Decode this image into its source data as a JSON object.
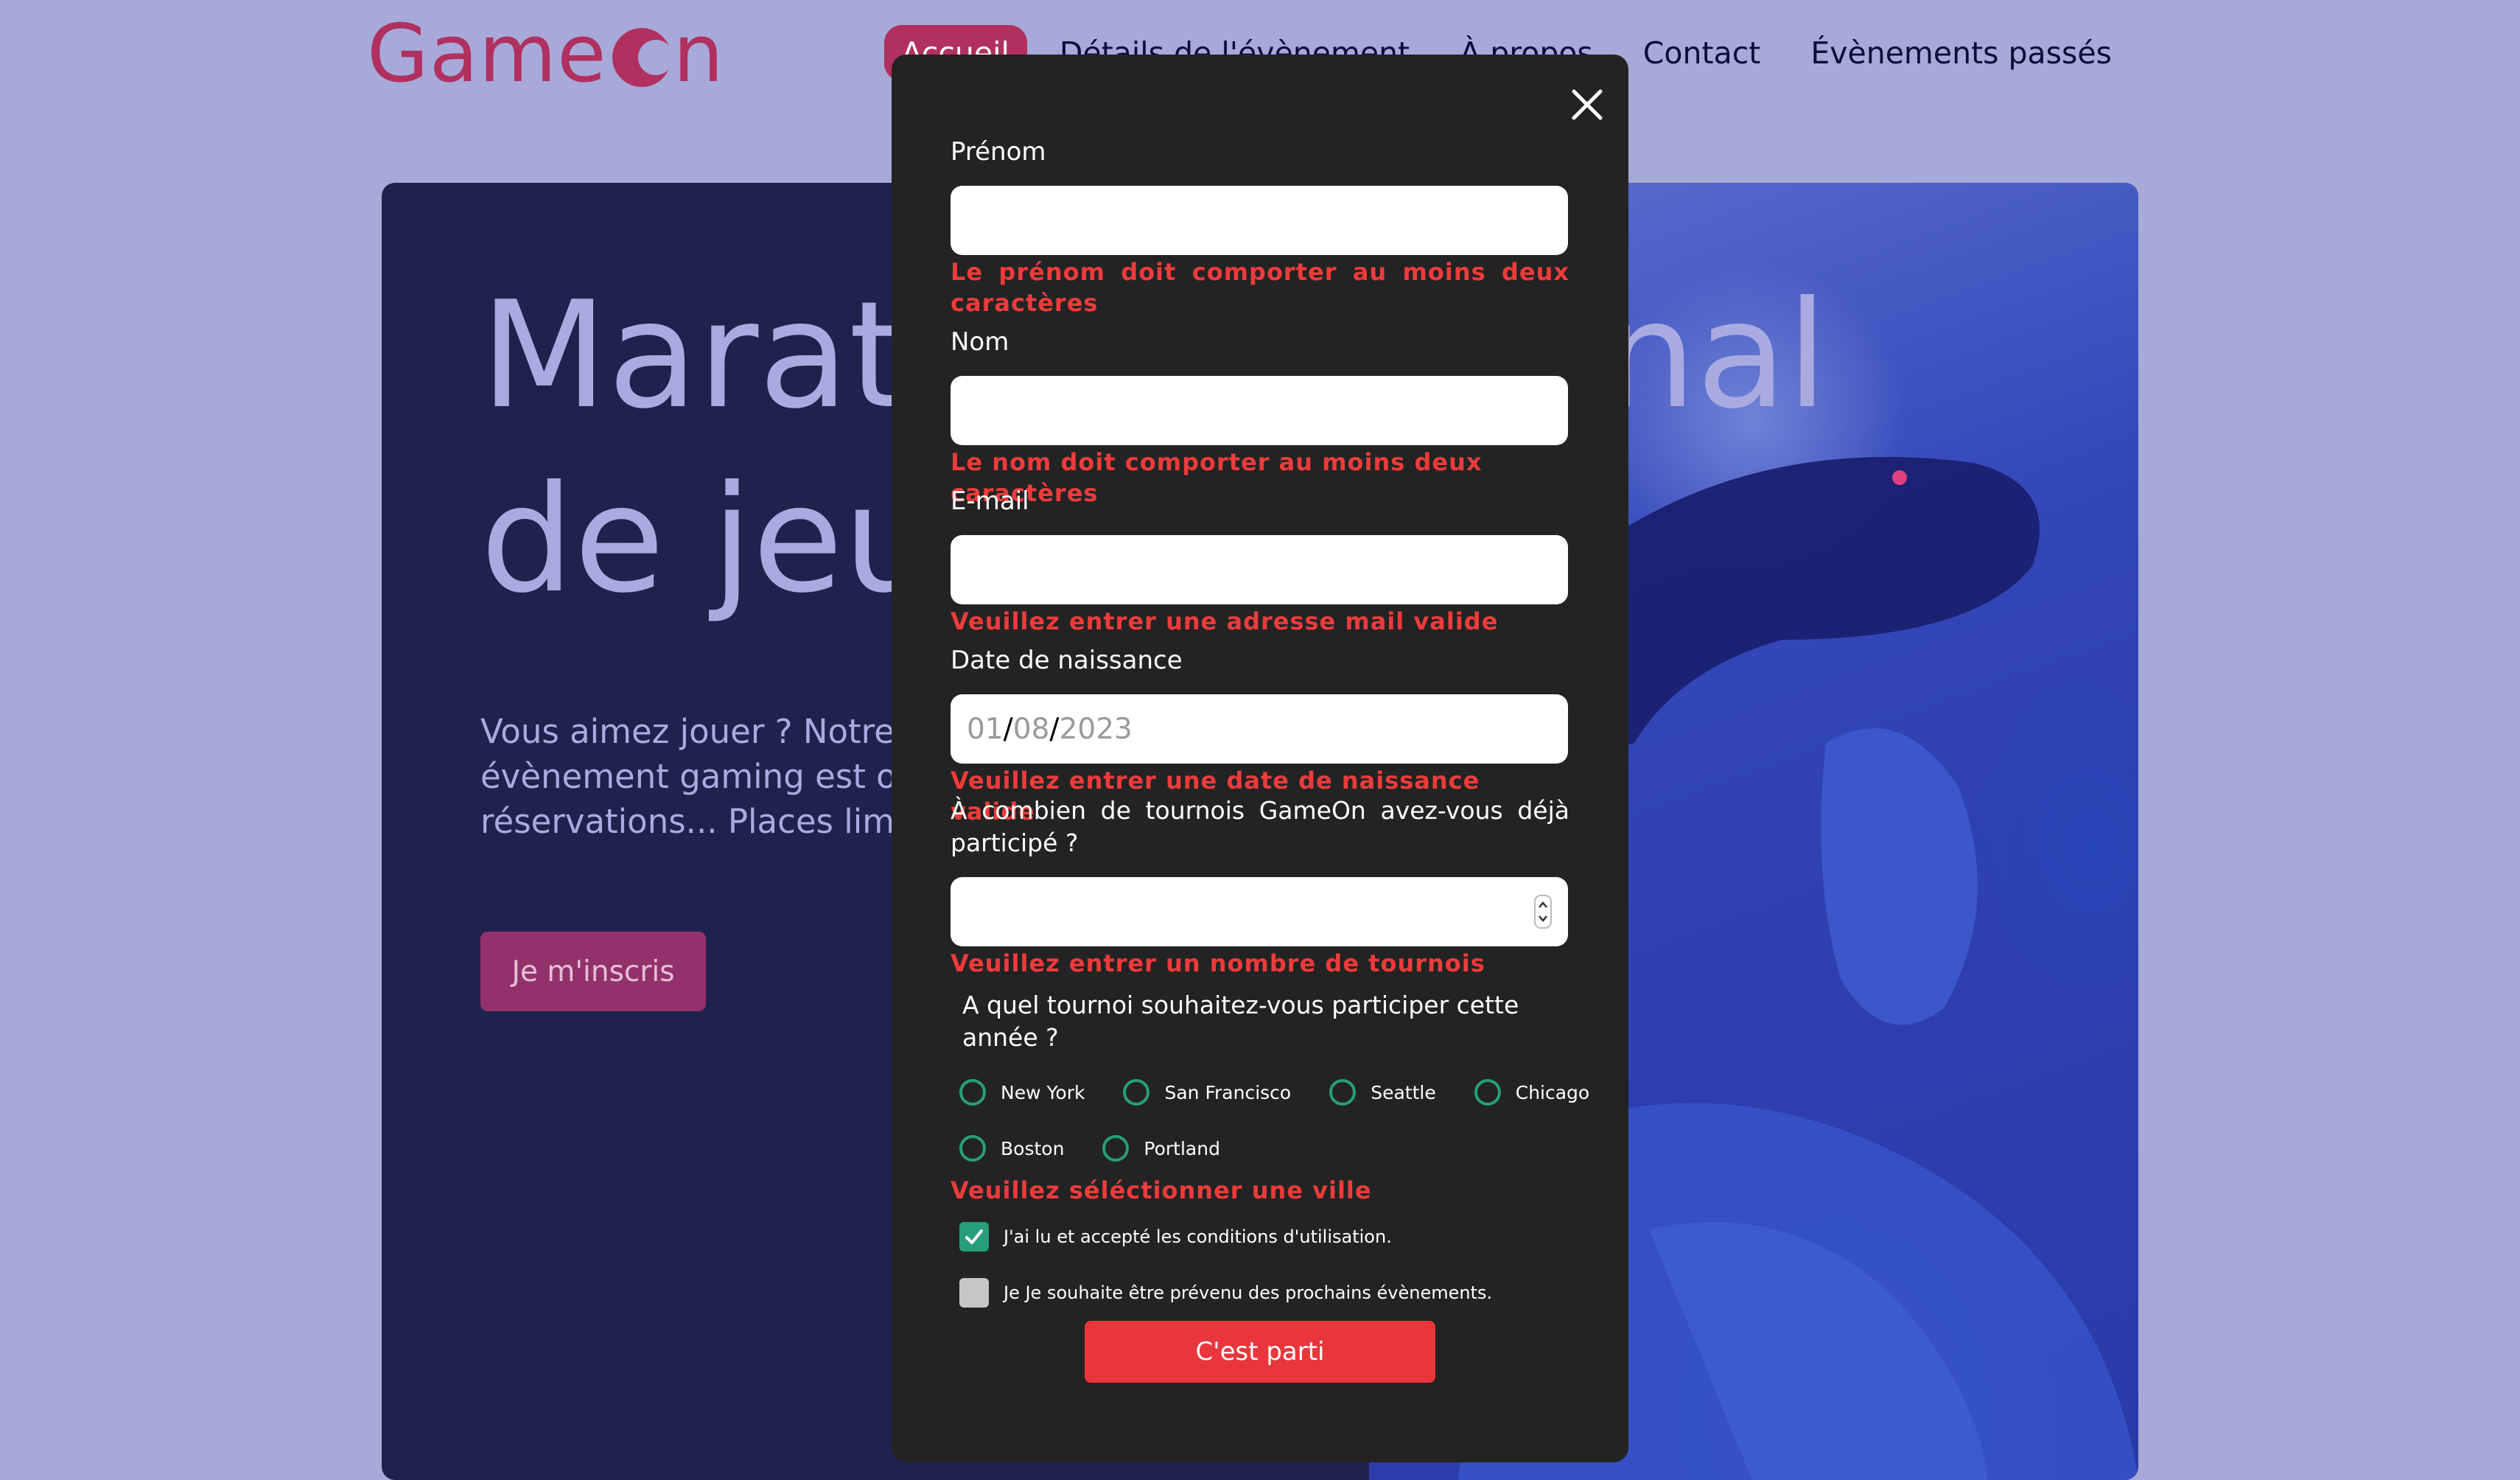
{
  "header": {
    "logo_text_start": "Game",
    "logo_text_end": "n",
    "nav": [
      {
        "label": "Accueil",
        "active": true
      },
      {
        "label": "Détails de l'évènement",
        "active": false
      },
      {
        "label": "À propos",
        "active": false
      },
      {
        "label": "Contact",
        "active": false
      },
      {
        "label": "Évènements passés",
        "active": false
      }
    ]
  },
  "hero": {
    "title_line1": "Marathon national",
    "title_line2": "de jeux vidéos",
    "text": "Vous aimez jouer ? Notre prochain évènement gaming est ouvert aux réservations... Places limitées !",
    "button_label": "Je m'inscris"
  },
  "modal": {
    "first_name": {
      "label": "Prénom",
      "value": "",
      "error": "Le prénom doit comporter au moins deux caractères"
    },
    "last_name": {
      "label": "Nom",
      "value": "",
      "error": "Le nom doit comporter au moins deux caractères"
    },
    "email": {
      "label": "E-mail",
      "value": "",
      "error": "Veuillez entrer une adresse mail valide"
    },
    "birthdate": {
      "label": "Date de naissance",
      "day": "01",
      "month": "08",
      "year": "2023",
      "error": "Veuillez entrer une date de naissance valide"
    },
    "quantity": {
      "label": "À combien de tournois GameOn avez-vous déjà participé ?",
      "value": "",
      "error": "Veuillez entrer un nombre de tournois"
    },
    "location": {
      "question": "A quel tournoi souhaitez-vous participer cette année ?",
      "options": [
        "New York",
        "San Francisco",
        "Seattle",
        "Chicago",
        "Boston",
        "Portland"
      ],
      "error": "Veuillez séléctionner une ville"
    },
    "terms": {
      "label": "J'ai lu et accepté les conditions d'utilisation.",
      "checked": true
    },
    "newsletter": {
      "label": "Je Je souhaite être prévenu des prochains évènements.",
      "checked": false
    },
    "submit_label": "C'est parti"
  },
  "colors": {
    "page_bg": "#a7a9d9",
    "brand": "#b0305f",
    "modal_bg": "#232323",
    "error": "#ee3b3b",
    "accent_green": "#279e7a",
    "submit": "#e8363c"
  }
}
